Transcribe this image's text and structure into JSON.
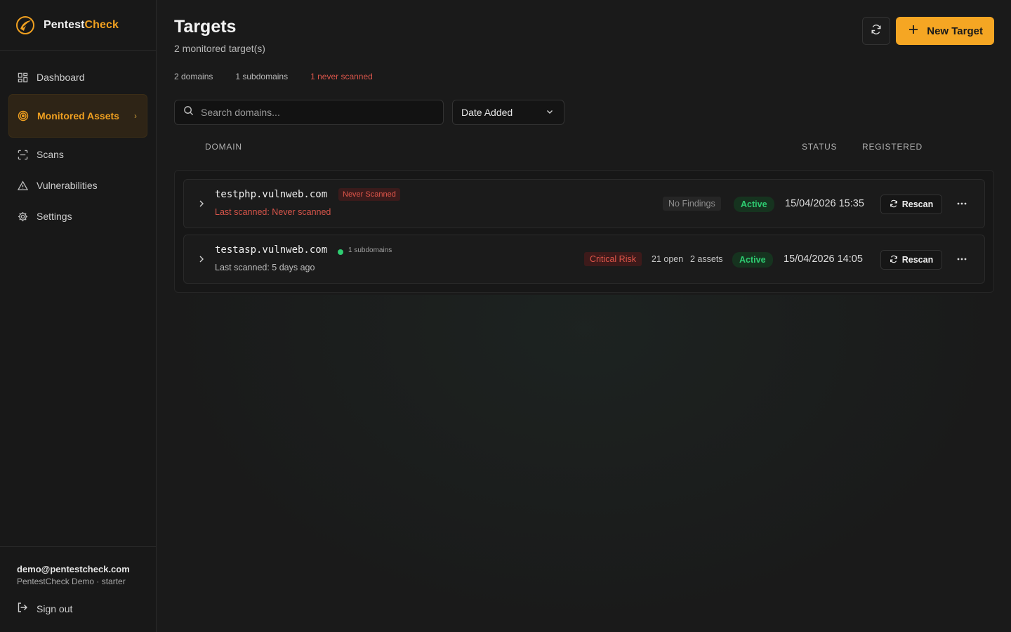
{
  "brand": {
    "name_main": "Pentest",
    "name_accent": "Check"
  },
  "sidebar": {
    "items": [
      {
        "label": "Dashboard",
        "icon": "dashboard-grid-icon"
      },
      {
        "label": "Monitored Assets",
        "icon": "target-icon",
        "active": true
      },
      {
        "label": "Scans",
        "icon": "scan-icon"
      },
      {
        "label": "Vulnerabilities",
        "icon": "warning-triangle-icon"
      },
      {
        "label": "Settings",
        "icon": "gear-icon"
      }
    ],
    "chevron": "›"
  },
  "user": {
    "email": "demo@pentestcheck.com",
    "org": "PentestCheck Demo · starter",
    "signout": "Sign out"
  },
  "header": {
    "title": "Targets",
    "subtitle": "2 monitored target(s)",
    "new_target": "New Target"
  },
  "stats": {
    "domains": "2 domains",
    "subdomains": "1 subdomains",
    "never_scanned": "1 never scanned"
  },
  "filters": {
    "search_placeholder": "Search domains...",
    "sort_value": "Date Added"
  },
  "columns": {
    "domain": "DOMAIN",
    "status": "STATUS",
    "registered": "REGISTERED"
  },
  "rows": [
    {
      "domain": "testphp.vulnweb.com",
      "tag": "Never Scanned",
      "last_scanned": "Last scanned: Never scanned",
      "findings": "No Findings",
      "status": "Active",
      "registered": "15/04/2026 15:35",
      "rescan": "Rescan"
    },
    {
      "domain": "testasp.vulnweb.com",
      "subdomains": "1 subdomains",
      "last_scanned": "Last scanned: 5 days ago",
      "risk": "Critical Risk",
      "open": "21 open",
      "assets": "2 assets",
      "status": "Active",
      "registered": "15/04/2026 14:05",
      "rescan": "Rescan"
    }
  ],
  "colors": {
    "accent": "#f5a623",
    "danger": "#e0564a",
    "success": "#2ecc71",
    "background": "#1a1a1a"
  }
}
